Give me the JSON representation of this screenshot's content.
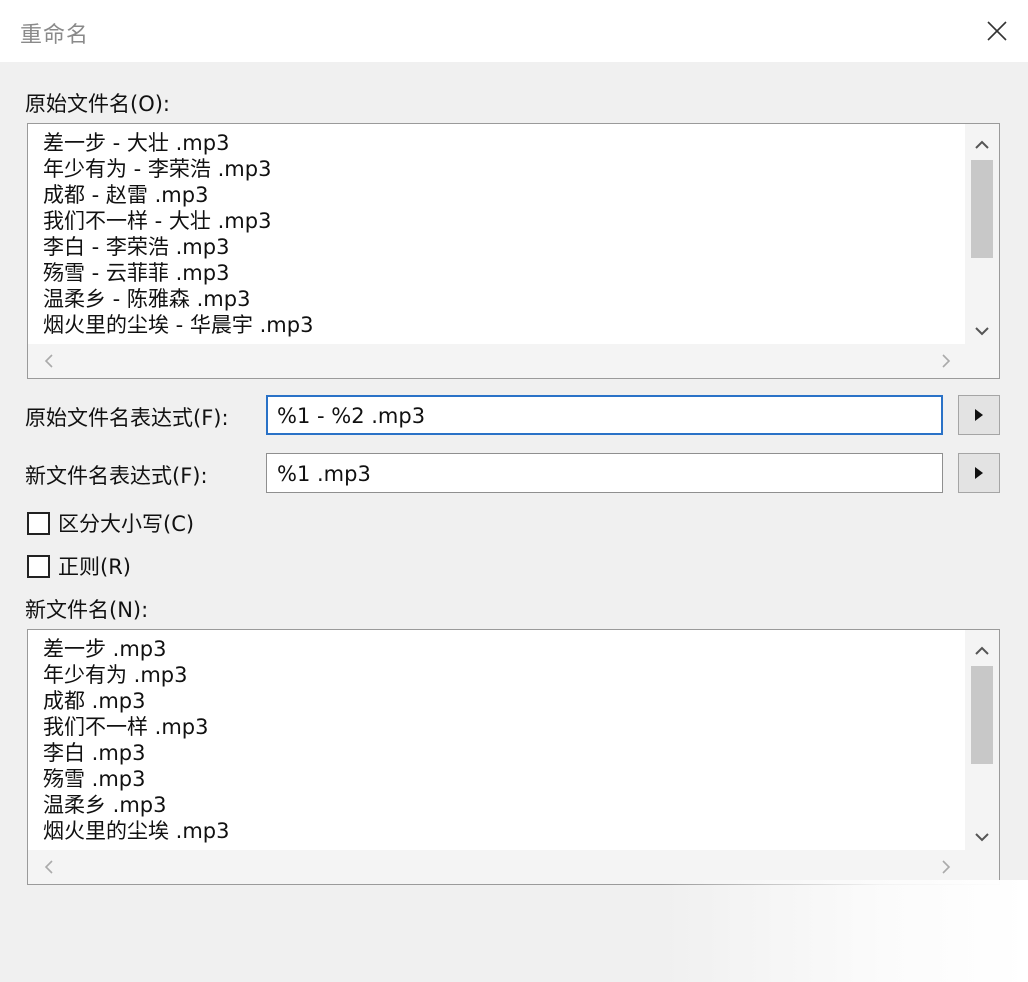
{
  "window": {
    "title": "重命名",
    "close_icon": "close-icon"
  },
  "original_list": {
    "label": "原始文件名(O):",
    "items": [
      "差一步 - 大壮 .mp3",
      "年少有为 - 李荣浩 .mp3",
      "成都 - 赵雷 .mp3",
      "我们不一样 - 大壮 .mp3",
      "李白 - 李荣浩 .mp3",
      "殇雪 - 云菲菲 .mp3",
      "温柔乡 - 陈雅森 .mp3",
      "烟火里的尘埃 - 华晨宇 .mp3"
    ]
  },
  "original_expression": {
    "label": "原始文件名表达式(F):",
    "value": "%1 - %2 .mp3",
    "button_icon": "play-triangle-icon"
  },
  "new_expression": {
    "label": "新文件名表达式(F):",
    "value": "%1 .mp3",
    "button_icon": "play-triangle-icon"
  },
  "options": {
    "case_sensitive": {
      "label": "区分大小写(C)",
      "checked": false
    },
    "regex": {
      "label": "正则(R)",
      "checked": false
    }
  },
  "new_list": {
    "label": "新文件名(N):",
    "items": [
      "差一步 .mp3",
      "年少有为 .mp3",
      "成都 .mp3",
      "我们不一样 .mp3",
      "李白 .mp3",
      "殇雪 .mp3",
      "温柔乡 .mp3",
      "烟火里的尘埃 .mp3"
    ]
  }
}
